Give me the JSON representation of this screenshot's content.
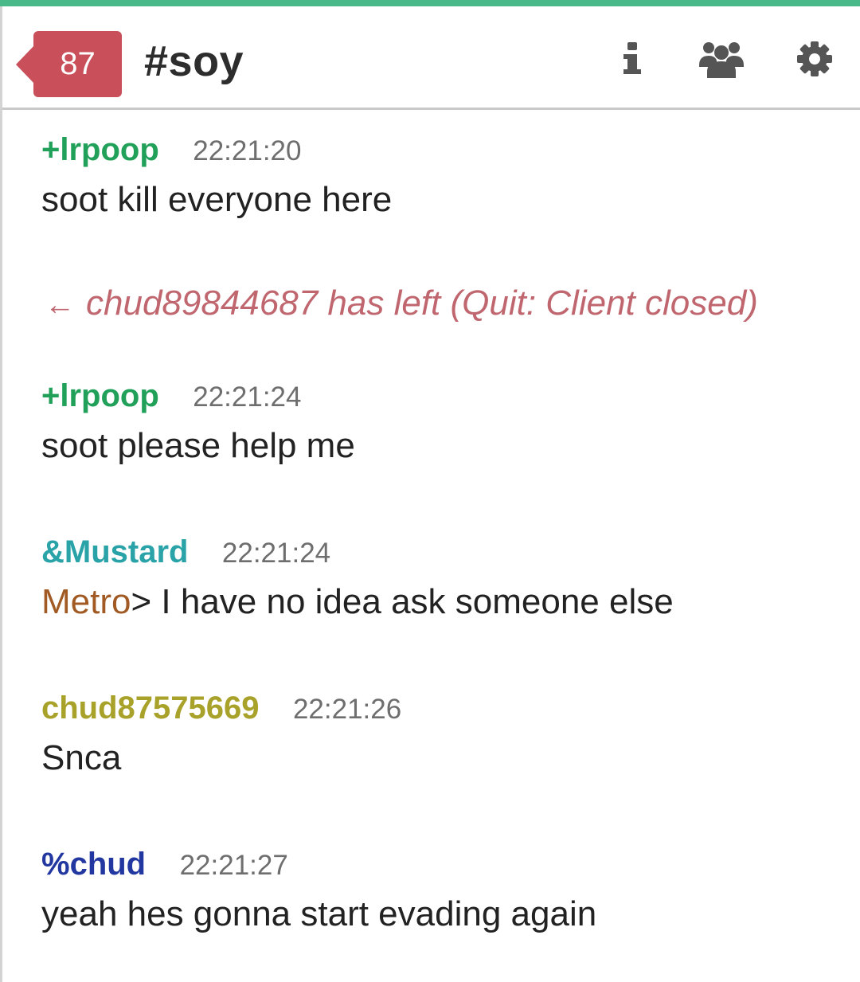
{
  "header": {
    "unread_count": "87",
    "channel_name": "#soy",
    "icons": {
      "info": "info-icon",
      "users": "users-icon",
      "settings": "gear-icon"
    }
  },
  "colors": {
    "accent": "#49b98a",
    "badge": "#c9505a",
    "nick_green": "#21a05a",
    "nick_teal": "#2aa3a8",
    "nick_olive": "#a9a22a",
    "nick_blue": "#2238a0",
    "mention": "#a15a23",
    "event": "#c0666f"
  },
  "messages": [
    {
      "nick": "+lrpoop",
      "time": "22:21:20",
      "text": "soot kill everyone here"
    },
    {
      "nick": "+lrpoop",
      "time": "22:21:24",
      "text": "soot please help me"
    },
    {
      "nick": "&Mustard",
      "time": "22:21:24",
      "mention": "Metro",
      "text": "> I have no idea ask someone else"
    },
    {
      "nick": "chud87575669",
      "time": "22:21:26",
      "text": "Snca"
    },
    {
      "nick": "%chud",
      "time": "22:21:27",
      "text": "yeah hes gonna start evading again"
    }
  ],
  "event": {
    "arrow": "←",
    "text": "chud89844687 has left (Quit: Client closed)"
  }
}
